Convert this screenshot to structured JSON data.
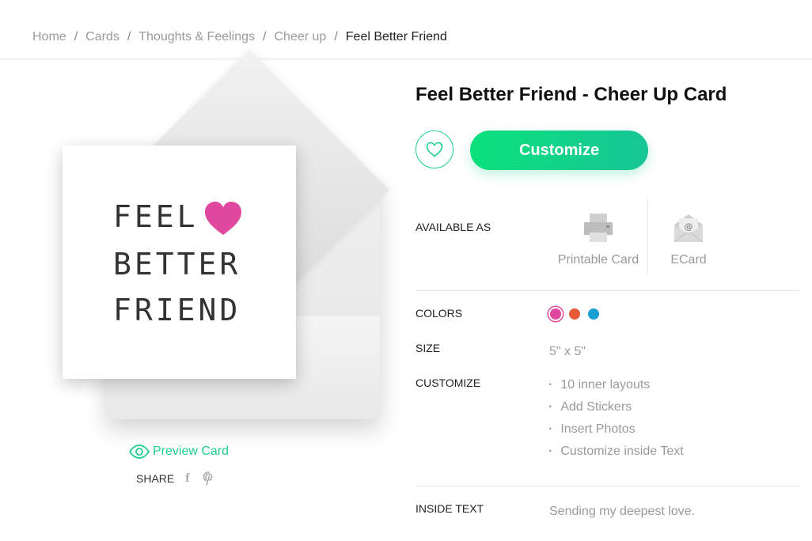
{
  "breadcrumb": {
    "items": [
      "Home",
      "Cards",
      "Thoughts & Feelings",
      "Cheer up"
    ],
    "separator": "/",
    "current": "Feel Better Friend"
  },
  "card": {
    "lines": [
      "FEEL",
      "BETTER",
      "FRIEND"
    ],
    "heart_color": "#e0479e"
  },
  "preview_label": "Preview Card",
  "share": {
    "label": "SHARE",
    "icons": [
      "facebook-icon",
      "pinterest-icon"
    ]
  },
  "product": {
    "title": "Feel Better Friend - Cheer Up Card",
    "customize_label": "Customize"
  },
  "available_as": {
    "label": "AVAILABLE AS",
    "options": [
      {
        "label": "Printable Card",
        "icon": "printer-icon"
      },
      {
        "label": "ECard",
        "icon": "email-envelope-icon"
      }
    ]
  },
  "colors": {
    "label": "COLORS",
    "swatches": [
      "#e0479e",
      "#e8593a",
      "#1a9fd4"
    ],
    "selected": 0
  },
  "size": {
    "label": "SIZE",
    "value": "5\" x 5\""
  },
  "customize": {
    "label": "CUSTOMIZE",
    "items": [
      "10 inner layouts",
      "Add Stickers",
      "Insert Photos",
      "Customize inside Text"
    ]
  },
  "inside_text": {
    "label": "INSIDE TEXT",
    "value": "Sending my deepest love."
  },
  "accent_color": "#1fcf8b"
}
